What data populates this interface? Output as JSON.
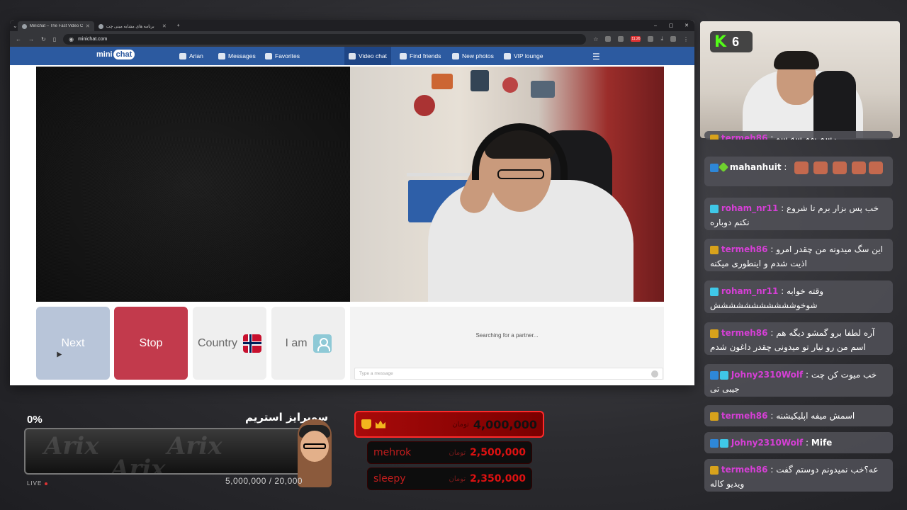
{
  "browser": {
    "tabs": [
      {
        "title": "Minichat – The Fast Video C",
        "active": true
      },
      {
        "title": "برنامه های مشابه مینی چت",
        "active": false
      }
    ],
    "new_tab": "+",
    "url": "minichat.com",
    "window_controls": [
      "–",
      "▢",
      "✕"
    ]
  },
  "site": {
    "logo_prefix": "mini",
    "logo_suffix": "chat",
    "nav": [
      {
        "label": "Arian",
        "icon": "user-icon"
      },
      {
        "label": "Messages",
        "icon": "envelope-icon"
      },
      {
        "label": "Favorites",
        "icon": "bookmark-icon"
      },
      {
        "label": "Video chat",
        "icon": "chat-bubble-icon",
        "active": true
      },
      {
        "label": "Find friends",
        "icon": "search-icon"
      },
      {
        "label": "New photos",
        "icon": "photo-icon"
      },
      {
        "label": "VIP lounge",
        "icon": "crown-icon"
      }
    ],
    "buttons": {
      "next": "Next",
      "stop": "Stop",
      "country": "Country",
      "iam": "I am"
    },
    "status": "Searching for a partner...",
    "message_placeholder": "Type a message"
  },
  "stream": {
    "viewer_count": "6",
    "goal": {
      "percent_label": "0%",
      "title": "سوپرایز استریم",
      "amount": "5,000,000 / 20,000",
      "progress": 0,
      "live_label": "LIVE"
    },
    "donations": [
      {
        "name": "",
        "unit": "تومان",
        "amount": "4,000,000"
      },
      {
        "name": "mehrok",
        "unit": "تومان",
        "amount": "2,500,000"
      },
      {
        "name": "sleepy",
        "unit": "تومان",
        "amount": "2,350,000"
      }
    ]
  },
  "chat": [
    {
      "user": "termeh86",
      "badges": [
        "gold"
      ],
      "text": "رسم بهم سه سو",
      "color": "#d63fd6"
    },
    {
      "user": "mahanhuit",
      "badges": [
        "blue",
        "green"
      ],
      "text": "",
      "emotes": 5,
      "color": "#ffffff"
    },
    {
      "user": "roham_nr11",
      "badges": [
        "cyan"
      ],
      "text": "خب پس بزار برم تا شروع نکنم دوباره",
      "color": "#d63fd6"
    },
    {
      "user": "termeh86",
      "badges": [
        "gold"
      ],
      "text": "این سگ میدونه من چقدر امرو اذیت شدم و اینطوری میکنه",
      "color": "#d63fd6"
    },
    {
      "user": "roham_nr11",
      "badges": [
        "cyan"
      ],
      "text": "وقته خوابه شوخوششششششششششش",
      "color": "#d63fd6"
    },
    {
      "user": "termeh86",
      "badges": [
        "gold"
      ],
      "text": "آره لطفا برو گمشو دیگه هم اسم من رو نیار تو میدونی چقدر داغون شدم",
      "color": "#d63fd6"
    },
    {
      "user": "Johny2310Wolf",
      "badges": [
        "blue",
        "cyan"
      ],
      "text": "خب میوت کن چت جیبی تی",
      "color": "#d63fd6"
    },
    {
      "user": "termeh86",
      "badges": [
        "gold"
      ],
      "text": "اسمش میفه اپلیکیشنه",
      "color": "#d63fd6"
    },
    {
      "user": "Johny2310Wolf",
      "badges": [
        "blue",
        "cyan"
      ],
      "text": "Mife",
      "color": "#d63fd6"
    },
    {
      "user": "termeh86",
      "badges": [
        "gold"
      ],
      "text": "عه؟خب نمیدونم دوستم گفت ویدیو کاله",
      "color": "#d63fd6"
    }
  ]
}
